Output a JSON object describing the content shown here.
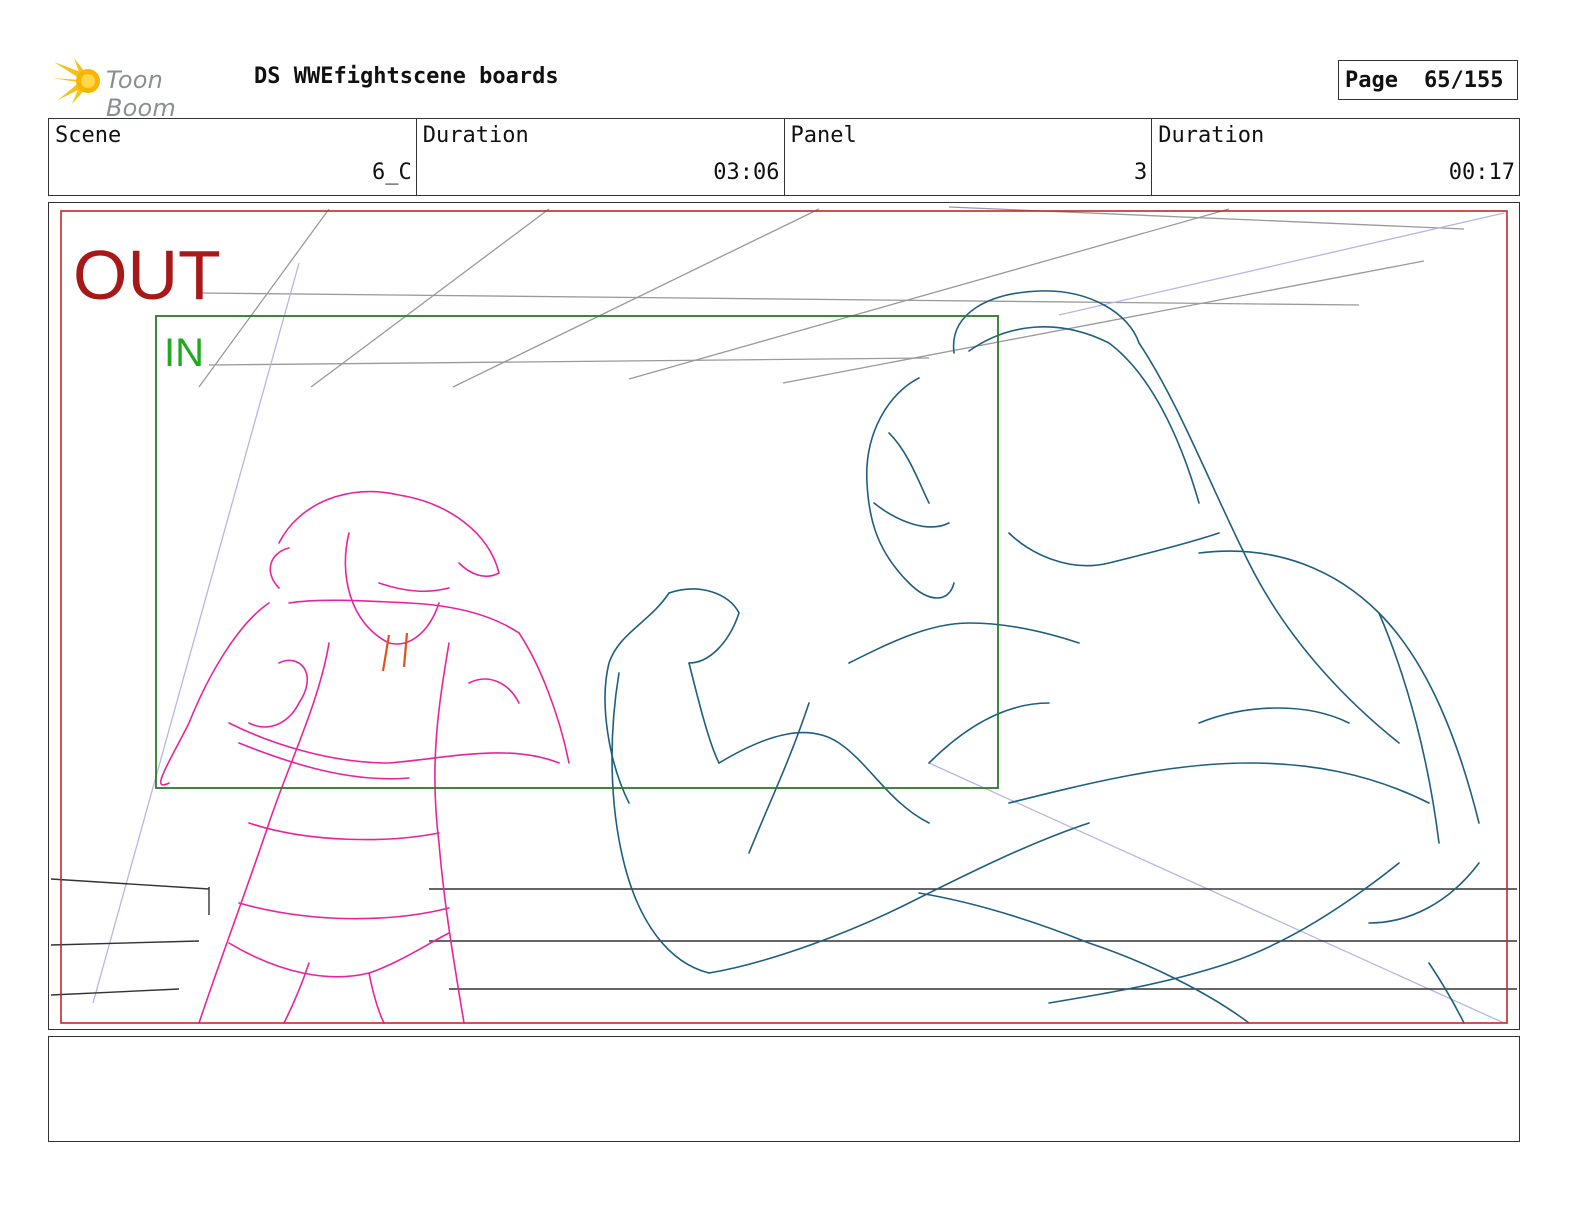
{
  "header": {
    "logo_text": "Toon Boom",
    "title": "DS WWEfightscene boards",
    "page_label": "Page",
    "page_number": "65/155"
  },
  "info": {
    "scene_label": "Scene",
    "scene_value": "6_C",
    "scene_duration_label": "Duration",
    "scene_duration_value": "03:06",
    "panel_label": "Panel",
    "panel_value": "3",
    "panel_duration_label": "Duration",
    "panel_duration_value": "00:17"
  },
  "frame": {
    "out_label": "OUT",
    "in_label": "IN",
    "colors": {
      "out_frame": "#c0282d",
      "out_text": "#a81818",
      "in_frame": "#2a7a2a",
      "in_text": "#1faa1f",
      "character_left": "#e8249c",
      "character_right": "#1e5f80",
      "ring_ropes": "#333333"
    }
  },
  "notes": {
    "text": ""
  }
}
